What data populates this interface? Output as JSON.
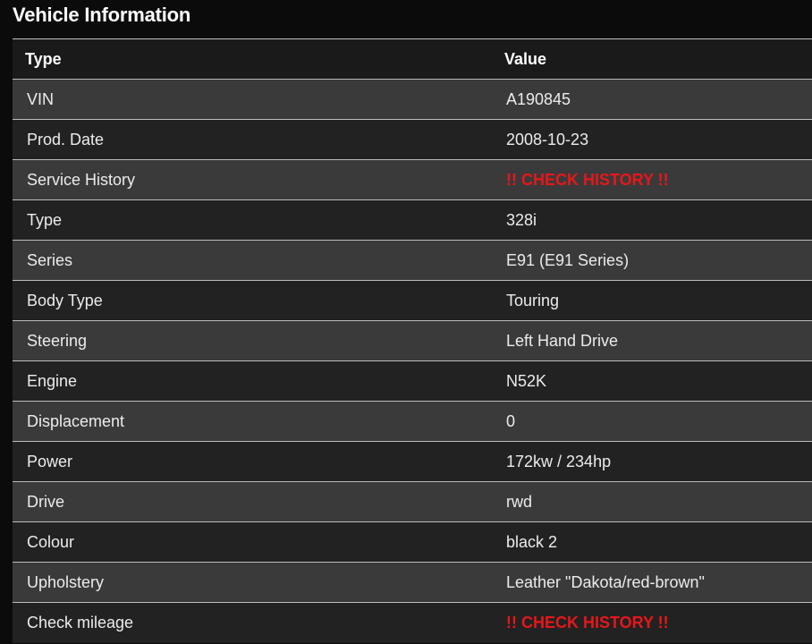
{
  "page": {
    "title": "Vehicle Information"
  },
  "table": {
    "headers": {
      "type": "Type",
      "value": "Value"
    },
    "rows": [
      {
        "type": "VIN",
        "value": "A190845",
        "warning": false
      },
      {
        "type": "Prod. Date",
        "value": "2008-10-23",
        "warning": false
      },
      {
        "type": "Service History",
        "value": "!! CHECK HISTORY !!",
        "warning": true
      },
      {
        "type": "Type",
        "value": "328i",
        "warning": false
      },
      {
        "type": "Series",
        "value": "E91 (E91 Series)",
        "warning": false
      },
      {
        "type": "Body Type",
        "value": "Touring",
        "warning": false
      },
      {
        "type": "Steering",
        "value": "Left Hand Drive",
        "warning": false
      },
      {
        "type": "Engine",
        "value": "N52K",
        "warning": false
      },
      {
        "type": "Displacement",
        "value": "0",
        "warning": false
      },
      {
        "type": "Power",
        "value": "172kw / 234hp",
        "warning": false
      },
      {
        "type": "Drive",
        "value": "rwd",
        "warning": false
      },
      {
        "type": "Colour",
        "value": "black 2",
        "warning": false
      },
      {
        "type": "Upholstery",
        "value": "Leather \"Dakota/red-brown\"",
        "warning": false
      },
      {
        "type": "Check mileage",
        "value": "!! CHECK HISTORY !!",
        "warning": true
      }
    ]
  },
  "colors": {
    "background": "#0b0b0b",
    "row_odd": "#3a3a3a",
    "row_even": "#222222",
    "header_row": "#1a1a1a",
    "warning_text": "#e8161a",
    "divider": "#bdbdbd"
  }
}
